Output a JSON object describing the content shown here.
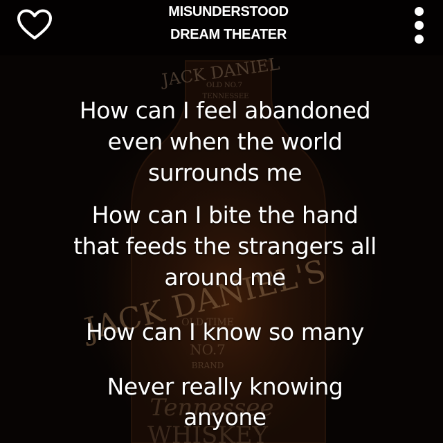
{
  "header": {
    "song_title": "MISUNDERSTOOD",
    "artist": "DREAM THEATER",
    "favorite_icon": "heart-outline-icon",
    "menu_icon": "more-vertical-icon"
  },
  "lyrics": {
    "lines": [
      "How can I feel abandoned",
      "even when the world",
      "surrounds me",
      "How can I bite the hand",
      "that feeds the strangers all",
      "around me",
      "How can I know so many",
      "Never really knowing",
      "anyone"
    ]
  },
  "background": {
    "label_top": "JACK DANIEL",
    "label_old_no7": "OLD NO.7",
    "label_tennessee": "TENNESSEE",
    "label_brand": "JACK DANIEL'S",
    "label_old_time": "OLD TIME",
    "label_no7": "NO.7",
    "label_brand_small": "BRAND",
    "label_tennessee_script": "Tennessee",
    "label_whiskey": "WHISKEY"
  },
  "colors": {
    "text": "#ffffff",
    "background": "#050302",
    "label_tint": "#8a6a4a"
  }
}
